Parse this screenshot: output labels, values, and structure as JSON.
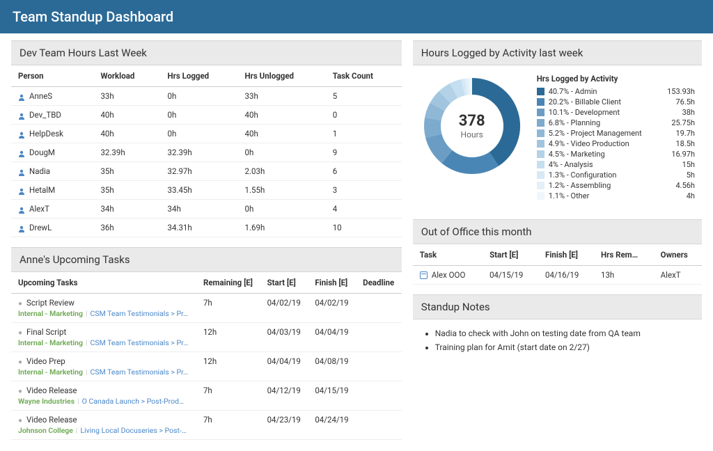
{
  "header": {
    "title": "Team Standup Dashboard"
  },
  "hours_panel": {
    "title": "Dev Team Hours Last Week",
    "cols": [
      "Person",
      "Workload",
      "Hrs Logged",
      "Hrs Unlogged",
      "Task Count"
    ],
    "rows": [
      {
        "person": "AnneS",
        "workload": "33h",
        "logged": "0h",
        "unlogged": "33h",
        "count": "5"
      },
      {
        "person": "Dev_TBD",
        "workload": "40h",
        "logged": "0h",
        "unlogged": "40h",
        "count": "0"
      },
      {
        "person": "HelpDesk",
        "workload": "40h",
        "logged": "0h",
        "unlogged": "40h",
        "count": "1"
      },
      {
        "person": "DougM",
        "workload": "32.39h",
        "logged": "32.39h",
        "unlogged": "0h",
        "count": "9"
      },
      {
        "person": "Nadia",
        "workload": "35h",
        "logged": "32.97h",
        "unlogged": "2.03h",
        "count": "6"
      },
      {
        "person": "HetalM",
        "workload": "35h",
        "logged": "33.45h",
        "unlogged": "1.55h",
        "count": "3"
      },
      {
        "person": "AlexT",
        "workload": "34h",
        "logged": "34h",
        "unlogged": "0h",
        "count": "4"
      },
      {
        "person": "DrewL",
        "workload": "36h",
        "logged": "34.31h",
        "unlogged": "1.69h",
        "count": "10"
      }
    ]
  },
  "tasks_panel": {
    "title": "Anne's Upcoming Tasks",
    "cols": [
      "Upcoming Tasks",
      "Remaining [E]",
      "Start [E]",
      "Finish [E]",
      "Deadline"
    ],
    "rows": [
      {
        "name": "Script Review",
        "bc1": "Internal - Marketing",
        "bc2": "CSM Team Testimonials > Pr…",
        "remaining": "7h",
        "start": "04/02/19",
        "finish": "04/02/19",
        "deadline": ""
      },
      {
        "name": "Final Script",
        "bc1": "Internal - Marketing",
        "bc2": "CSM Team Testimonials > Pr…",
        "remaining": "12h",
        "start": "04/03/19",
        "finish": "04/04/19",
        "deadline": ""
      },
      {
        "name": "Video Prep",
        "bc1": "Internal - Marketing",
        "bc2": "CSM Team Testimonials > Pr…",
        "remaining": "12h",
        "start": "04/04/19",
        "finish": "04/08/19",
        "deadline": ""
      },
      {
        "name": "Video Release",
        "bc1": "Wayne Industries",
        "bc2": "O Canada Launch > Post-Prod…",
        "remaining": "7h",
        "start": "04/12/19",
        "finish": "04/15/19",
        "deadline": ""
      },
      {
        "name": "Video Release",
        "bc1": "Johnson College",
        "bc2": "Living Local Docuseries > Post-…",
        "remaining": "7h",
        "start": "04/23/19",
        "finish": "04/24/19",
        "deadline": ""
      }
    ]
  },
  "activity_panel": {
    "title": "Hours Logged by Activity last week",
    "legend_title": "Hrs Logged by Activity",
    "center_value": "378",
    "center_label": "Hours"
  },
  "chart_data": {
    "type": "pie",
    "title": "Hrs Logged by Activity",
    "total": 378,
    "unit": "Hours",
    "series": [
      {
        "name": "Admin",
        "percent": 40.7,
        "value": 153.93,
        "color": "#2b6a97"
      },
      {
        "name": "Billable Client",
        "percent": 20.2,
        "value": 76.5,
        "color": "#4a86b5"
      },
      {
        "name": "Development",
        "percent": 10.1,
        "value": 38,
        "color": "#6b9dc4"
      },
      {
        "name": "Planning",
        "percent": 6.8,
        "value": 25.75,
        "color": "#7dabcd"
      },
      {
        "name": "Project Management",
        "percent": 5.2,
        "value": 19.7,
        "color": "#8fb8d6"
      },
      {
        "name": "Video Production",
        "percent": 4.9,
        "value": 18.5,
        "color": "#a1c5df"
      },
      {
        "name": "Marketing",
        "percent": 4.5,
        "value": 16.97,
        "color": "#b3d2e8"
      },
      {
        "name": "Analysis",
        "percent": 4.0,
        "value": 15,
        "color": "#c5dff1"
      },
      {
        "name": "Configuration",
        "percent": 1.3,
        "value": 5,
        "color": "#d7e9f5"
      },
      {
        "name": "Assembling",
        "percent": 1.2,
        "value": 4.56,
        "color": "#e3f0f9"
      },
      {
        "name": "Other",
        "percent": 1.1,
        "value": 4,
        "color": "#eff7fc"
      }
    ]
  },
  "ooo_panel": {
    "title": "Out of Office this month",
    "cols": [
      "Task",
      "Start [E]",
      "Finish [E]",
      "Hrs Rem…",
      "Owners"
    ],
    "rows": [
      {
        "task": "Alex OOO",
        "start": "04/15/19",
        "finish": "04/16/19",
        "hrs": "13h",
        "owners": "AlexT"
      }
    ]
  },
  "notes_panel": {
    "title": "Standup Notes",
    "items": [
      "Nadia to check with John on testing date from QA team",
      "Training plan for Amit (start date on 2/27)"
    ]
  }
}
